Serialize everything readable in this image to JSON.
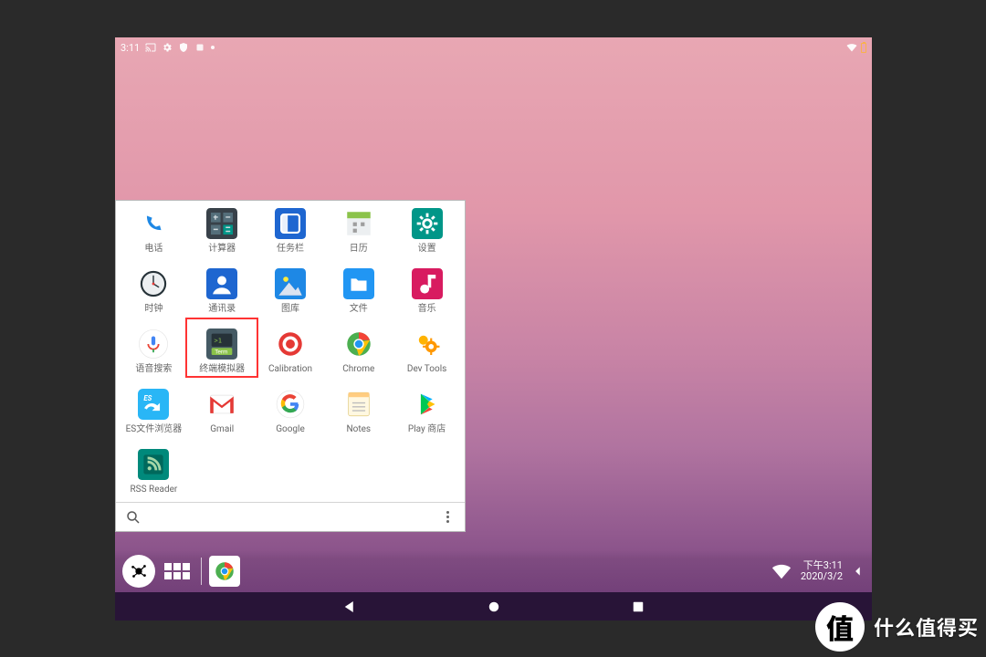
{
  "statusbar": {
    "time": "3:11"
  },
  "drawer": {
    "highlight_index": 11,
    "apps": [
      {
        "id": "phone",
        "label": "电话"
      },
      {
        "id": "calculator",
        "label": "计算器"
      },
      {
        "id": "taskbar",
        "label": "任务栏"
      },
      {
        "id": "calendar",
        "label": "日历"
      },
      {
        "id": "settings",
        "label": "设置"
      },
      {
        "id": "clock",
        "label": "时钟"
      },
      {
        "id": "contacts",
        "label": "通讯录"
      },
      {
        "id": "gallery",
        "label": "图库"
      },
      {
        "id": "files",
        "label": "文件"
      },
      {
        "id": "music",
        "label": "音乐"
      },
      {
        "id": "voice-search",
        "label": "语音搜索"
      },
      {
        "id": "terminal",
        "label": "终端模拟器"
      },
      {
        "id": "calibration",
        "label": "Calibration"
      },
      {
        "id": "chrome",
        "label": "Chrome"
      },
      {
        "id": "dev-tools",
        "label": "Dev Tools"
      },
      {
        "id": "es-file",
        "label": "ES文件浏览器"
      },
      {
        "id": "gmail",
        "label": "Gmail"
      },
      {
        "id": "google",
        "label": "Google"
      },
      {
        "id": "notes",
        "label": "Notes"
      },
      {
        "id": "play-store",
        "label": "Play 商店"
      },
      {
        "id": "rss-reader",
        "label": "RSS Reader"
      }
    ]
  },
  "taskbar": {
    "clock_time": "下午3:11",
    "clock_date": "2020/3/2"
  },
  "watermark": {
    "logo_char": "值",
    "text": "什么值得买"
  },
  "colors": {
    "highlight": "#f33",
    "nav": "#281437",
    "accent_blue": "#2196f3",
    "accent_teal": "#009688"
  }
}
